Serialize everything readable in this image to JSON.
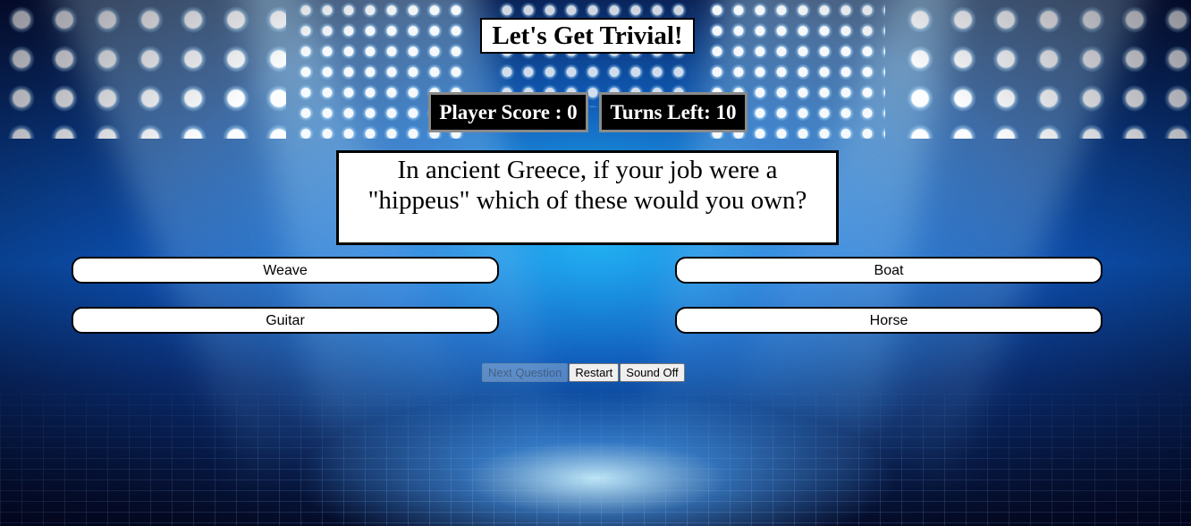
{
  "header": {
    "title": "Let's Get Trivial!"
  },
  "stats": {
    "score_label": "Player Score : 0",
    "turns_label": "Turns Left: 10"
  },
  "question": {
    "text": "In ancient Greece, if your job were a \"hippeus\" which of these would you own?"
  },
  "answers": [
    {
      "label": "Weave"
    },
    {
      "label": "Boat"
    },
    {
      "label": "Guitar"
    },
    {
      "label": "Horse"
    }
  ],
  "controls": {
    "next_label": "Next Question",
    "next_disabled": true,
    "restart_label": "Restart",
    "sound_label": "Sound Off"
  },
  "colors": {
    "background_accent": "#0c56b8",
    "panel_white": "#ffffff",
    "stat_black": "#000000"
  }
}
